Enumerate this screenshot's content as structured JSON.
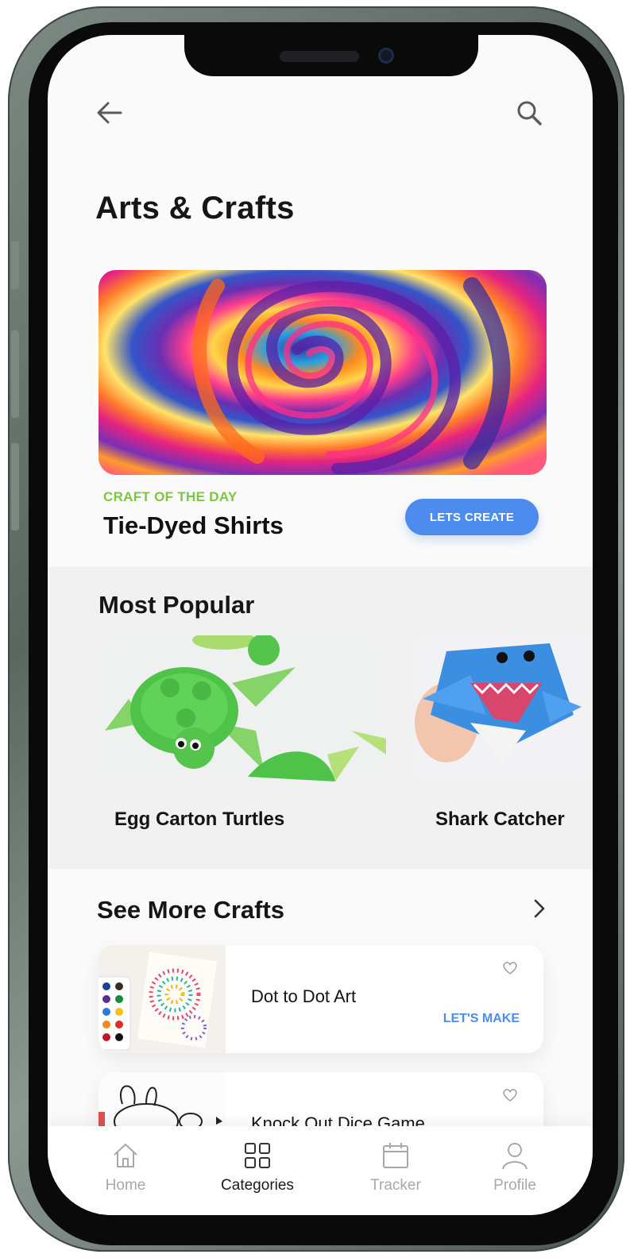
{
  "header": {
    "title": "Arts & Crafts"
  },
  "featured": {
    "label": "CRAFT OF THE DAY",
    "name": "Tie-Dyed Shirts",
    "button_label": "LETS CREATE"
  },
  "popular": {
    "title": "Most Popular",
    "items": [
      {
        "name": "Egg Carton Turtles"
      },
      {
        "name": "Shark Catcher"
      }
    ]
  },
  "more_crafts": {
    "title": "See More Crafts",
    "items": [
      {
        "name": "Dot to Dot Art",
        "action": "LET'S MAKE"
      },
      {
        "name": "Knock Out Dice Game"
      }
    ]
  },
  "tabs": [
    {
      "label": "Home",
      "icon": "home-icon",
      "active": false
    },
    {
      "label": "Categories",
      "icon": "grid-icon",
      "active": true
    },
    {
      "label": "Tracker",
      "icon": "calendar-icon",
      "active": false
    },
    {
      "label": "Profile",
      "icon": "user-icon",
      "active": false
    }
  ],
  "colors": {
    "accent": "#4e8bef",
    "label_green": "#7ec540",
    "background": "#fafafa"
  }
}
